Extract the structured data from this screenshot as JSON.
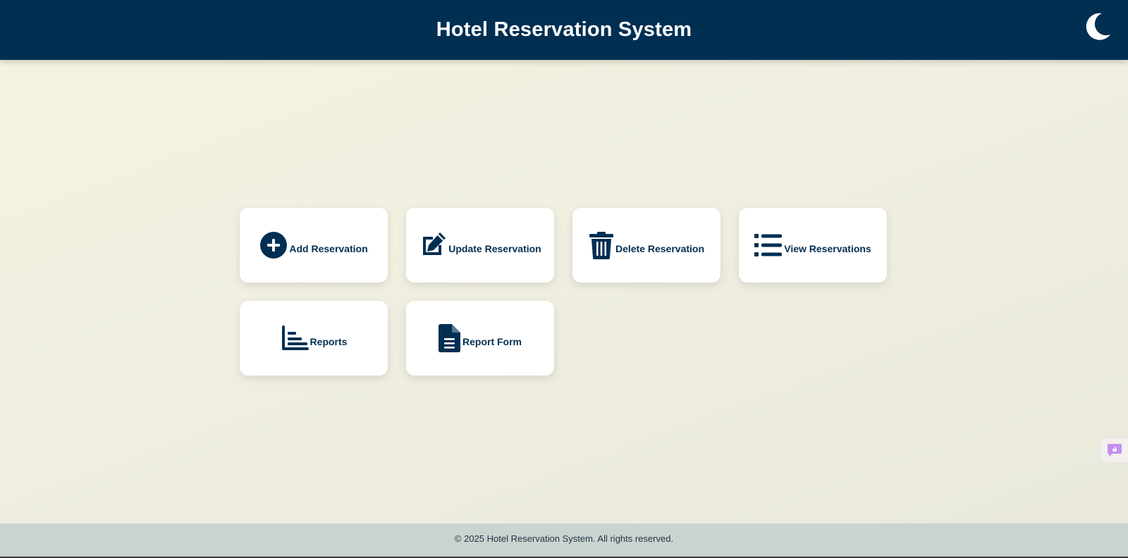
{
  "header": {
    "title": "Hotel Reservation System",
    "theme_toggle_icon": "moon-icon"
  },
  "menu": {
    "cards": [
      {
        "label": "Add Reservation",
        "icon": "plus-circle-icon"
      },
      {
        "label": "Update Reservation",
        "icon": "edit-icon"
      },
      {
        "label": "Delete Reservation",
        "icon": "trash-icon"
      },
      {
        "label": "View Reservations",
        "icon": "list-icon"
      },
      {
        "label": "Reports",
        "icon": "bar-chart-icon"
      },
      {
        "label": "Report Form",
        "icon": "document-icon"
      }
    ]
  },
  "footer": {
    "text": "© 2025 Hotel Reservation System. All rights reserved."
  },
  "colors": {
    "primary": "#002f52",
    "card_background": "#ffffff",
    "footer_background": "#cbd3d0",
    "feedback_accent": "#c58ff2"
  }
}
